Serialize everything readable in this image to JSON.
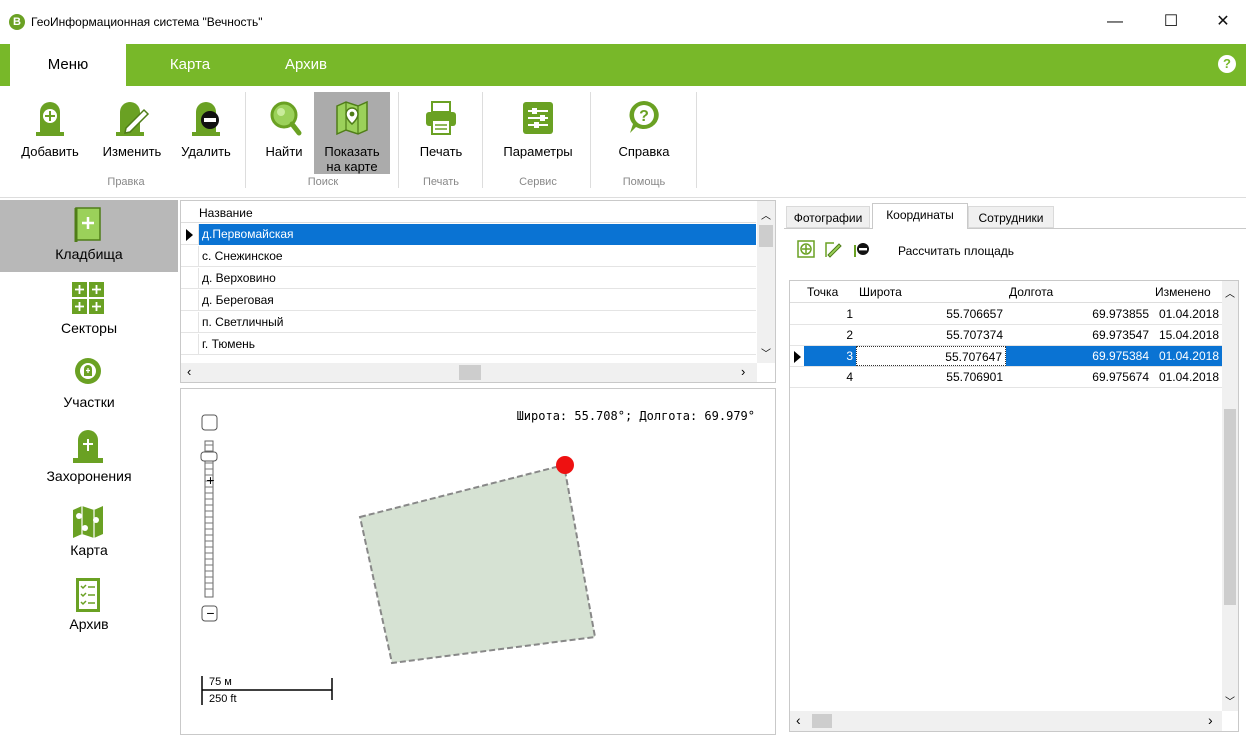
{
  "window": {
    "logo": "В",
    "title": "ГеоИнформационная система \"Вечность\"",
    "minimize": "—",
    "maximize": "☐",
    "close": "✕"
  },
  "menu": {
    "tabs": [
      "Меню",
      "Карта",
      "Архив"
    ],
    "active_tab": "Меню",
    "help": "?"
  },
  "ribbon": {
    "buttons": {
      "add": "Добавить",
      "edit": "Изменить",
      "delete": "Удалить",
      "find": "Найти",
      "show_on_map_1": "Показать",
      "show_on_map_2": "на карте",
      "print": "Печать",
      "params": "Параметры",
      "help": "Справка"
    },
    "groups": [
      "Правка",
      "Поиск",
      "Печать",
      "Сервис",
      "Помощь"
    ]
  },
  "nav": {
    "items": [
      "Кладбища",
      "Секторы",
      "Участки",
      "Захоронения",
      "Карта",
      "Архив"
    ],
    "active": "Кладбища"
  },
  "list": {
    "header": "Название",
    "rows": [
      "д.Первомайская",
      "с. Снежинское",
      "д. Верховино",
      "д. Береговая",
      "п. Светличный",
      "г. Тюмень"
    ],
    "selected_index": 0
  },
  "map": {
    "coords_readout": "Широта: 55.708°; Долгота: 69.979°",
    "scale_metric": "75 м",
    "scale_imperial": "250 ft",
    "zoom_in": "+",
    "zoom_out": "−",
    "polygon_fill": "#d6e2d3",
    "marker_color": "#ee1111"
  },
  "right": {
    "tabs": [
      "Фотографии",
      "Координаты",
      "Сотрудники"
    ],
    "active_tab": "Координаты",
    "calc_area": "Рассчитать площадь",
    "grid": {
      "columns": [
        "Точка",
        "Широта",
        "Долгота",
        "Изменено"
      ],
      "rows": [
        [
          "1",
          "55.706657",
          "69.973855",
          "01.04.2018"
        ],
        [
          "2",
          "55.707374",
          "69.973547",
          "15.04.2018"
        ],
        [
          "3",
          "55.707647",
          "69.975384",
          "01.04.2018"
        ],
        [
          "4",
          "55.706901",
          "69.975674",
          "01.04.2018"
        ]
      ],
      "selected_index": 2
    }
  },
  "colors": {
    "accent": "#78b829",
    "selection": "#0a73d3",
    "icon_green": "#6aa123"
  }
}
